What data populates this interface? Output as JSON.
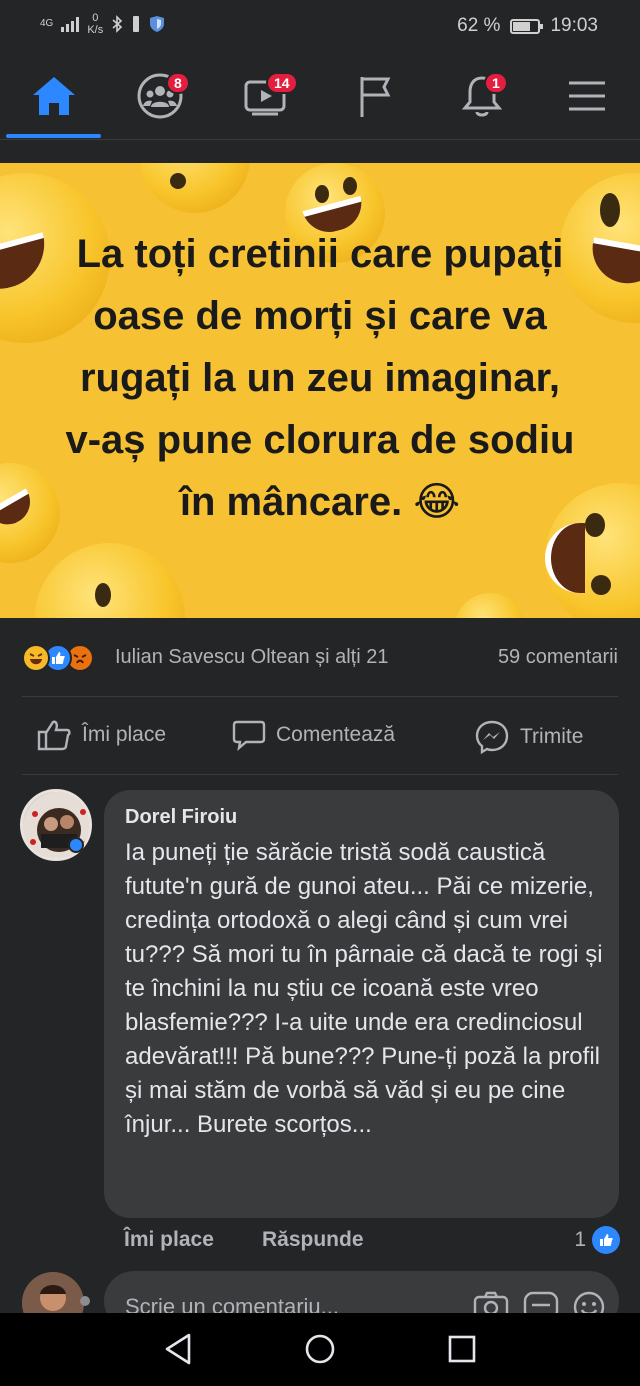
{
  "status_bar": {
    "network": "4G",
    "speed_value": "0",
    "speed_unit": "K/s",
    "battery": "62 %",
    "time": "19:03"
  },
  "nav": {
    "groups_badge": "8",
    "watch_badge": "14",
    "notifications_badge": "1",
    "accent_color": "#2d88ff",
    "badge_color": "#e41e3f"
  },
  "post": {
    "image_text": "La toți cretinii care pupați oase de morți și care va rugați la un zeu imaginar, v-aș pune clorura de sodiu în mâncare.",
    "image_emoji": "😂",
    "reaction_names": "Iulian Savescu Oltean și alți 21",
    "comments_count": "59 comentarii",
    "like_label": "Îmi place",
    "comment_label": "Comentează",
    "share_label": "Trimite"
  },
  "comment": {
    "author": "Dorel Firoiu",
    "text": "Ia puneți ție sărăcie tristă sodă caustică futute'n gură de gunoi ateu... Păi ce mizerie, credința ortodoxă o alegi  când și cum vrei tu??? Să mori tu în pârnaie că dacă te rogi și te închini la nu știu ce icoană este vreo blasfemie??? I-a uite unde era credinciosul adevărat!!! Pă bune??? Pune-ți poză la profil și mai stăm de vorbă să văd și eu pe cine înjur... Burete scorțos...",
    "like_label": "Îmi place",
    "reply_label": "Răspunde",
    "like_count": "1"
  },
  "composer": {
    "placeholder": "Scrie un comentariu..."
  }
}
